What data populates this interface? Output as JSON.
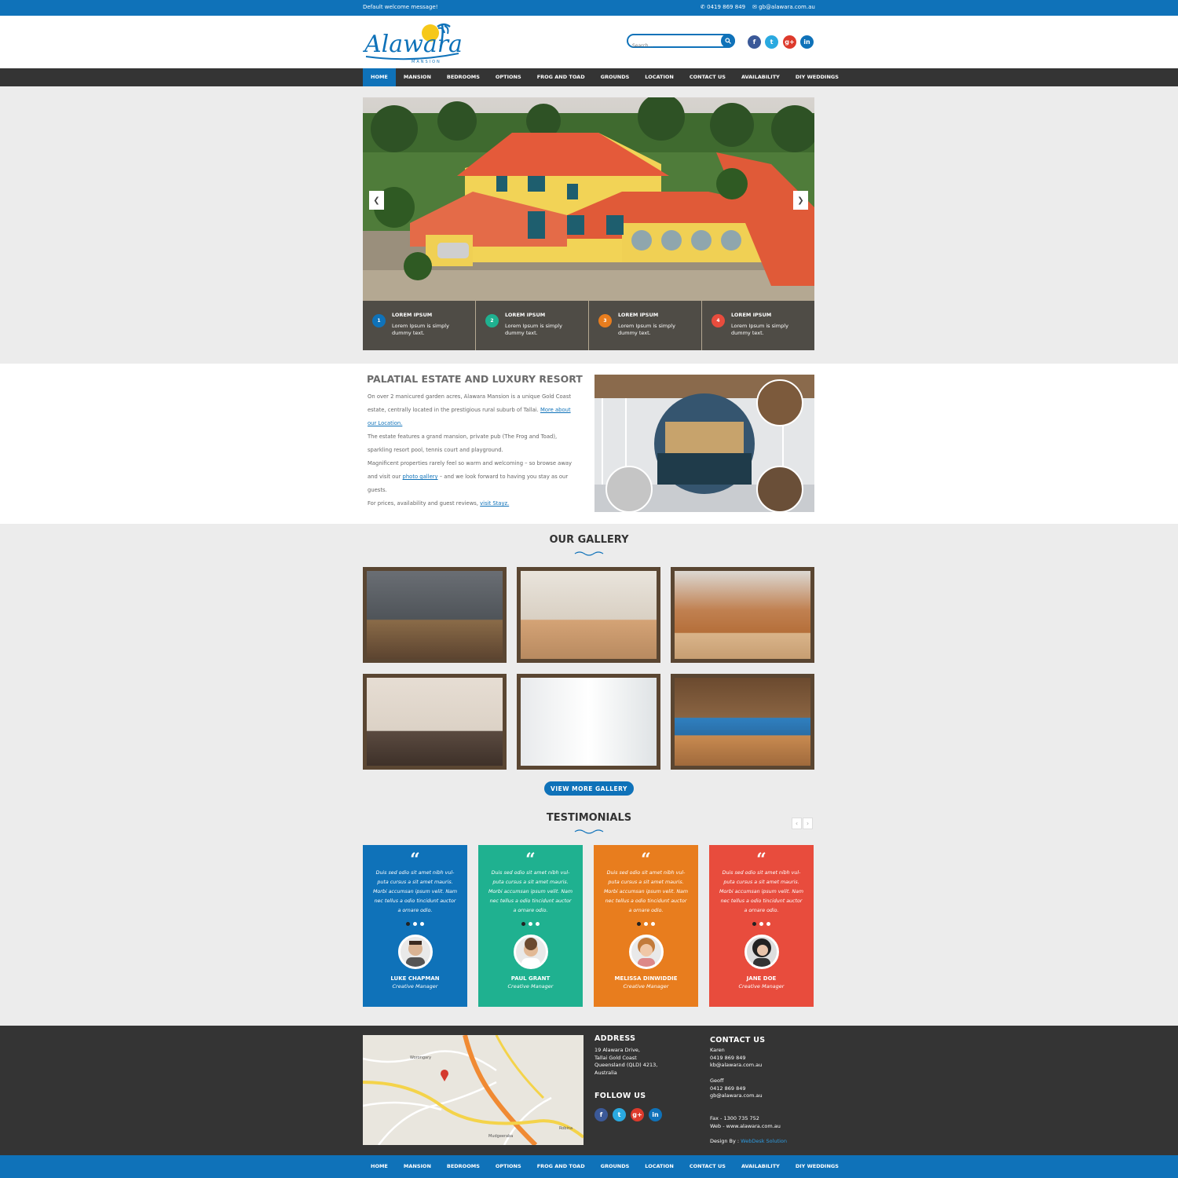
{
  "topbar": {
    "welcome": "Default welcome message!",
    "phone": "0419 869 849",
    "email": "gb@alawara.com.au"
  },
  "header": {
    "logo_text": "Alawara",
    "logo_sub": "MANSION",
    "search_placeholder": "Search..."
  },
  "social": {
    "icons": [
      "facebook-icon",
      "twitter-icon",
      "google-plus-icon",
      "linkedin-icon"
    ],
    "colors": [
      "#3b5998",
      "#2aa9e0",
      "#dd3a2c",
      "#0f72b9"
    ]
  },
  "nav": {
    "items": [
      "HOME",
      "MANSION",
      "BEDROOMS",
      "OPTIONS",
      "FROG AND TOAD",
      "GROUNDS",
      "LOCATION",
      "CONTACT US",
      "AVAILABILITY",
      "DIY WEDDINGS"
    ],
    "active": "HOME"
  },
  "slider": {
    "features": [
      {
        "num": "1",
        "title": "LOREM IPSUM",
        "desc": "Lorem Ipsum is simply dummy text.",
        "color": "#0f72b9"
      },
      {
        "num": "2",
        "title": "LOREM IPSUM",
        "desc": "Lorem Ipsum is simply dummy text.",
        "color": "#1fb190"
      },
      {
        "num": "3",
        "title": "LOREM IPSUM",
        "desc": "Lorem Ipsum is simply dummy text.",
        "color": "#e87d1e"
      },
      {
        "num": "4",
        "title": "LOREM IPSUM",
        "desc": "Lorem Ipsum is simply dummy text.",
        "color": "#e84c3d"
      }
    ]
  },
  "about": {
    "title": "PALATIAL ESTATE AND LUXURY RESORT",
    "p1a": "On over 2 manicured garden acres, Alawara Mansion is a unique Gold Coast estate, centrally located in the prestigious rural suburb of Tallai.",
    "p1link": "More about our Location.",
    "p2": "The estate features a grand mansion, private pub (The Frog and Toad), sparkling resort pool, tennis court and playground.",
    "p3a": "Magnificent properties rarely feel so warm and welcoming – so browse away and visit our",
    "p3link": "photo gallery",
    "p3b": "– and we look forward to having you stay as our guests.",
    "p4a": "For prices, availability and guest reviews,",
    "p4link": "visit Stayz."
  },
  "gallery": {
    "title": "OUR GALLERY",
    "button": "VIEW MORE GALLERY"
  },
  "testimonials": {
    "title": "TESTIMONIALS",
    "items": [
      {
        "quote": "Duis sed odio sit amet nibh vul-puta cursus a sit amet mauris. Morbi accumsan ipsum velit. Nam nec tellus a odio tincidunt auctor a ornare odio.",
        "name": "LUKE CHAPMAN",
        "role": "Creative Manager",
        "color": "#0f72b9"
      },
      {
        "quote": "Duis sed odio sit amet nibh vul-puta cursus a sit amet mauris. Morbi accumsan ipsum velit. Nam nec tellus a odio tincidunt auctor a ornare odio.",
        "name": "PAUL GRANT",
        "role": "Creative Manager",
        "color": "#1fb190"
      },
      {
        "quote": "Duis sed odio sit amet nibh vul-puta cursus a sit amet mauris. Morbi accumsan ipsum velit. Nam nec tellus a odio tincidunt auctor a ornare odio.",
        "name": "MELISSA DINWIDDIE",
        "role": "Creative Manager",
        "color": "#e87d1e"
      },
      {
        "quote": "Duis sed odio sit amet nibh vul-puta cursus a sit amet mauris. Morbi accumsan ipsum velit. Nam nec tellus a odio tincidunt auctor a ornare odio.",
        "name": "JANE DOE",
        "role": "Creative Manager",
        "color": "#e84c3d"
      }
    ]
  },
  "footer": {
    "address_title": "ADDRESS",
    "address": [
      "19 Alawara Drive,",
      "Tallai Gold Coast",
      "Queensland (QLD) 4213,",
      "Australia"
    ],
    "follow_title": "FOLLOW US",
    "contact_title": "CONTACT US",
    "contact": [
      "Karen",
      "0419 869 849",
      "kb@alawara.com.au",
      "",
      "Geoff",
      "0412 869 849",
      "gb@alawara.com.au",
      "",
      "",
      "Fax - 1300 735 752",
      "Web - www.alawara.com.au",
      "",
      "Design By :"
    ],
    "designer": "WebDesk Solution",
    "map_labels": [
      "Mudgeeraba",
      "Robina",
      "Worongary"
    ]
  }
}
